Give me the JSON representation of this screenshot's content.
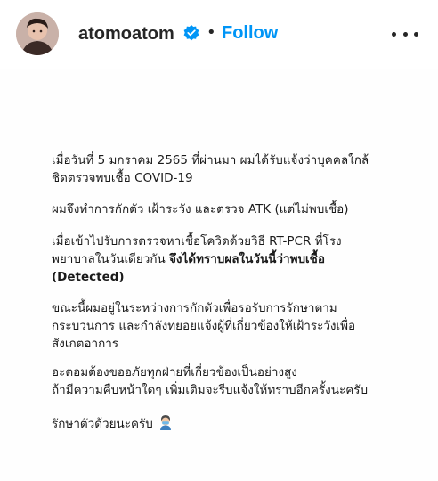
{
  "header": {
    "username": "atomoatom",
    "separator": "•",
    "follow_label": "Follow",
    "verified": true,
    "accent_color": "#0095f6",
    "icons": [
      "avatar",
      "verified-badge-icon",
      "more-options-icon"
    ]
  },
  "post": {
    "paragraphs": [
      {
        "lines": [
          "เมื่อวันที่ 5 มกราคม 2565 ที่ผ่านมา ผมได้รับแจ้งว่าบุคคลใกล้",
          "ชิดตรวจพบเชื้อ COVID-19"
        ]
      },
      {
        "lines": [
          "ผมจึงทำการกักตัว เฝ้าระวัง และตรวจ ATK (แต่ไม่พบเชื้อ)"
        ]
      },
      {
        "line1": "เมื่อเข้าไปรับการตรวจหาเชื้อโควิดด้วยวิธี RT-PCR ที่โรง",
        "line2_normal": "พยาบาลในวันเดียวกัน ",
        "line2_bold": "จึงได้ทราบผลในวันนี้ว่าพบเชื้อ",
        "line3_bold": "(Detected)"
      },
      {
        "lines": [
          "ขณะนี้ผมอยู่ในระหว่างการกักตัวเพื่อรอรับการรักษาตาม",
          "กระบวนการ และกำลังทยอยแจ้งผู้ที่เกี่ยวข้องให้เฝ้าระวังเพื่อ",
          "สังเกตอาการ"
        ]
      },
      {
        "lines": [
          "อะตอมต้องขออภัยทุกฝ่ายที่เกี่ยวข้องเป็นอย่างสูง",
          "ถ้ามีความคืบหน้าใดๆ เพิ่มเติมจะรีบแจ้งให้ทราบอีกครั้งนะครับ"
        ]
      },
      {
        "text": "รักษาตัวด้วยนะครับ",
        "emoji": "person-with-mask-icon"
      }
    ]
  }
}
